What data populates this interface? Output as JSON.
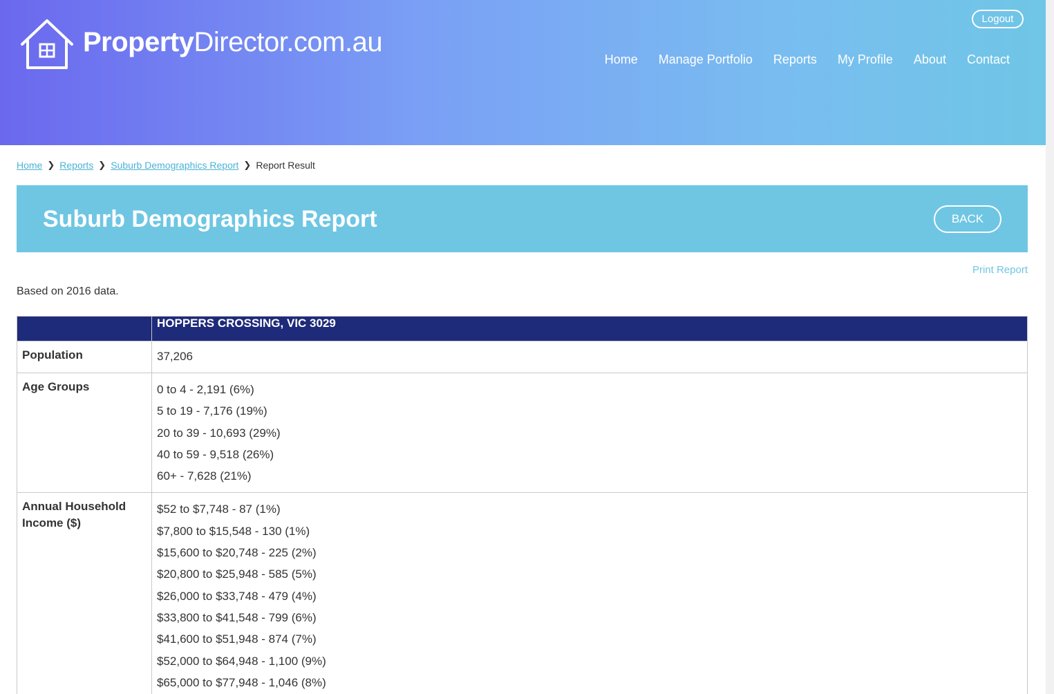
{
  "brand": {
    "strong": "Property",
    "light": "Director.com.au"
  },
  "header": {
    "logout": "Logout",
    "nav": [
      "Home",
      "Manage Portfolio",
      "Reports",
      "My Profile",
      "About",
      "Contact"
    ]
  },
  "breadcrumb": {
    "items": [
      "Home",
      "Reports",
      "Suburb Demographics Report"
    ],
    "current": "Report Result"
  },
  "title_bar": {
    "title": "Suburb Demographics Report",
    "back": "BACK"
  },
  "print_report": "Print Report",
  "based_on": "Based on 2016 data.",
  "table": {
    "header": "HOPPERS CROSSING, VIC 3029",
    "population_label": "Population",
    "population_value": "37,206",
    "age_label": "Age Groups",
    "age_values": [
      "0 to 4 - 2,191 (6%)",
      "5 to 19 - 7,176 (19%)",
      "20 to 39 - 10,693 (29%)",
      "40 to 59 - 9,518 (26%)",
      "60+ - 7,628 (21%)"
    ],
    "income_label": "Annual Household Income ($)",
    "income_values": [
      "$52 to $7,748 - 87 (1%)",
      "$7,800 to $15,548 - 130 (1%)",
      "$15,600 to $20,748 - 225 (2%)",
      "$20,800 to $25,948 - 585 (5%)",
      "$26,000 to $33,748 - 479 (4%)",
      "$33,800 to $41,548 - 799 (6%)",
      "$41,600 to $51,948 - 874 (7%)",
      "$52,000 to $64,948 - 1,100 (9%)",
      "$65,000 to $77,948 - 1,046 (8%)"
    ]
  }
}
